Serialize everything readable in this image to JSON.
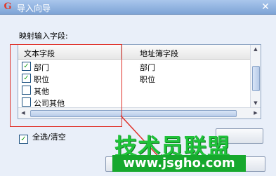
{
  "window": {
    "title": "导入向导",
    "app_icon": "G"
  },
  "mapping": {
    "label": "映射输入字段:"
  },
  "grid": {
    "headers": [
      "文本字段",
      "地址簿字段"
    ],
    "rows": [
      {
        "checked": true,
        "source": "部门",
        "target": "部门"
      },
      {
        "checked": true,
        "source": "职位",
        "target": "职位"
      },
      {
        "checked": false,
        "source": "其他",
        "target": ""
      },
      {
        "checked": false,
        "source": "公司其他",
        "target": ""
      }
    ]
  },
  "select_all": {
    "checked": true,
    "label": "全选/清空"
  },
  "watermark": {
    "text": "技术员联盟",
    "url": "www.jsgho.com"
  },
  "colors": {
    "highlight": "#e0322a",
    "check": "#21a121",
    "watermark": "#20c23a"
  },
  "icons": [
    "app-logo-icon",
    "close-icon",
    "checkmark-icon",
    "scroll-arrow-icon"
  ]
}
